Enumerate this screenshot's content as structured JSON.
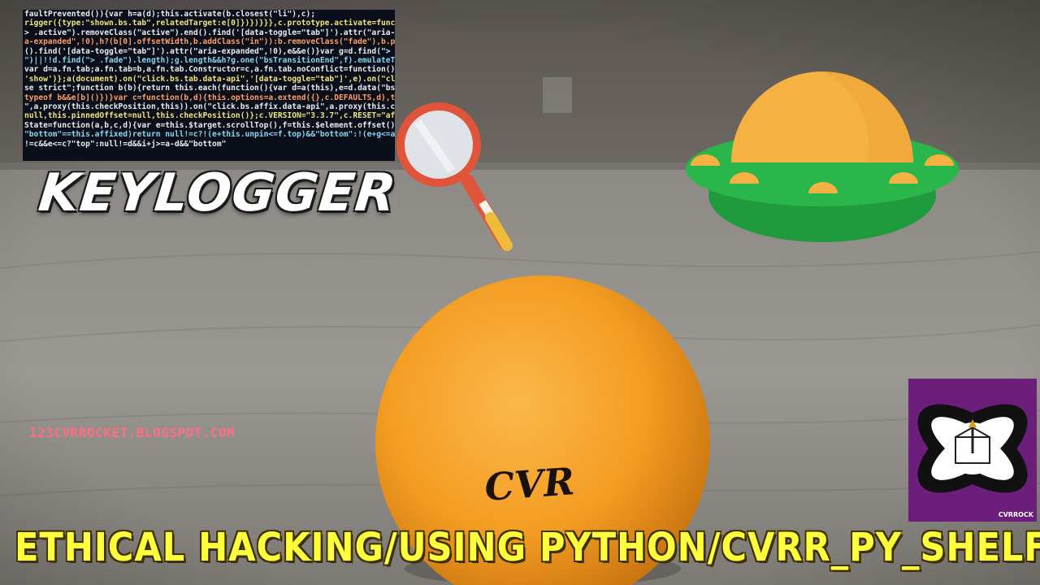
{
  "title": "KEYLOGGER",
  "blog_url": "123CVRROCKET.BLOGSPOT.COM",
  "banner": "ETHICAL HACKING/USING PYTHON/CVRR_PY_SHELF",
  "ball_text": "CVR",
  "logo_caption": "CVRROCK",
  "code_lines": [
    "faultPrevented()){var h=a(d);this.activate(b.closest(\"li\"),c);",
    "rigger({type:\"shown.bs.tab\",relatedTarget:e[0]})})}}},c.prototype.activate=function(b,d,e){func",
    "> .active\").removeClass(\"active\").end().find('[data-toggle=\"tab\"]').attr(\"aria-expanded\",!1),",
    "a-expanded\",!0),h?(b[0].offsetWidth,b.addClass(\"in\")):b.removeClass(\"fade\"),b.parent(\".dropdow",
    "().find('[data-toggle=\"tab\"]').attr(\"aria-expanded\",!0),e&&e()}var g=d.find(\"> .active\"),h=e&&",
    "\")||!!d.find(\"> .fade\").length);g.length&&h?g.one(\"bsTransitionEnd\",f).emulateTransitionEnd",
    "var d=a.fn.tab;a.fn.tab=b,a.fn.tab.Constructor=c,a.fn.tab.noConflict=function(){return a.fn.t",
    "'show')};a(document).on(\"click.bs.tab.data-api\",'[data-toggle=\"tab\"]',e).on(\"click.bs.tab.data",
    "se strict\";function b(b){return this.each(function(){var d=a(this),e=d.data(\"bs.affix\"),f=\"obj",
    "typeof b&&e[b]()})}var c=function(b,d){this.options=a.extend({},c.DEFAULTS,d),this.$target=a",
    "\",a.proxy(this.checkPosition,this)).on(\"click.bs.affix.data-api\",a.proxy(this.checkPositionWi",
    "null,this.pinnedOffset=null,this.checkPosition()};c.VERSION=\"3.3.7\",c.RESET=\"affix affix-top",
    "State=function(a,b,c,d){var e=this.$target.scrollTop(),f=this.$element.offset(),",
    "\"bottom\"==this.affixed)return null!=c?!(e+this.unpin<=f.top)&&\"bottom\":!(e+g<=a-d)&&",
    "!=c&&e<=c?\"top\":null!=d&&i+j>=a-d&&\"bottom\""
  ],
  "colors": {
    "code_bg": "#0b0f1a",
    "title_fill": "#ffffff",
    "banner_fill": "#ffff3c",
    "url_fill": "#ff6f82",
    "ball_orange": "#f7a52b",
    "ufo_dome": "#f6b143",
    "ufo_saucer": "#27b34a",
    "logo_purple": "#6b1f7a"
  },
  "icons": [
    "magnifying-glass-icon",
    "ufo-icon",
    "atom-logo-icon"
  ]
}
